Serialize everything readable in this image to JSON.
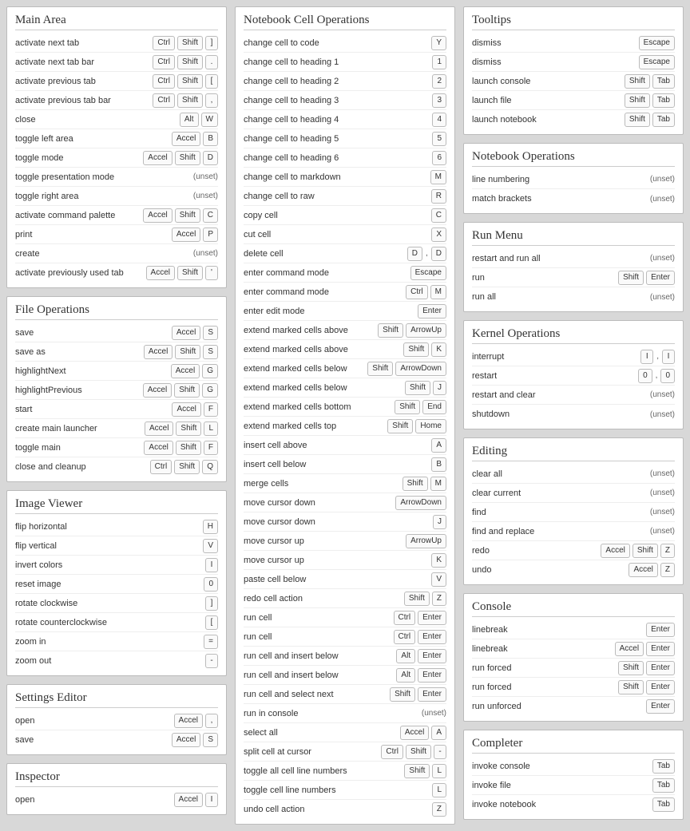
{
  "unset_label": "(unset)",
  "columns": [
    {
      "panels": [
        {
          "title": "Main Area",
          "rows": [
            {
              "label": "activate next tab",
              "keys": [
                "Ctrl",
                "Shift",
                "]"
              ]
            },
            {
              "label": "activate next tab bar",
              "keys": [
                "Ctrl",
                "Shift",
                "."
              ]
            },
            {
              "label": "activate previous tab",
              "keys": [
                "Ctrl",
                "Shift",
                "["
              ]
            },
            {
              "label": "activate previous tab bar",
              "keys": [
                "Ctrl",
                "Shift",
                ","
              ]
            },
            {
              "label": "close",
              "keys": [
                "Alt",
                "W"
              ]
            },
            {
              "label": "toggle left area",
              "keys": [
                "Accel",
                "B"
              ]
            },
            {
              "label": "toggle mode",
              "keys": [
                "Accel",
                "Shift",
                "D"
              ]
            },
            {
              "label": "toggle presentation mode",
              "unset": true
            },
            {
              "label": "toggle right area",
              "unset": true
            },
            {
              "label": "activate command palette",
              "keys": [
                "Accel",
                "Shift",
                "C"
              ]
            },
            {
              "label": "print",
              "keys": [
                "Accel",
                "P"
              ]
            },
            {
              "label": "create",
              "unset": true
            },
            {
              "label": "activate previously used tab",
              "keys": [
                "Accel",
                "Shift",
                "'"
              ]
            }
          ]
        },
        {
          "title": "File Operations",
          "rows": [
            {
              "label": "save",
              "keys": [
                "Accel",
                "S"
              ]
            },
            {
              "label": "save as",
              "keys": [
                "Accel",
                "Shift",
                "S"
              ]
            },
            {
              "label": "highlightNext",
              "keys": [
                "Accel",
                "G"
              ]
            },
            {
              "label": "highlightPrevious",
              "keys": [
                "Accel",
                "Shift",
                "G"
              ]
            },
            {
              "label": "start",
              "keys": [
                "Accel",
                "F"
              ]
            },
            {
              "label": "create main launcher",
              "keys": [
                "Accel",
                "Shift",
                "L"
              ]
            },
            {
              "label": "toggle main",
              "keys": [
                "Accel",
                "Shift",
                "F"
              ]
            },
            {
              "label": "close and cleanup",
              "keys": [
                "Ctrl",
                "Shift",
                "Q"
              ]
            }
          ]
        },
        {
          "title": "Image Viewer",
          "rows": [
            {
              "label": "flip horizontal",
              "keys": [
                "H"
              ]
            },
            {
              "label": "flip vertical",
              "keys": [
                "V"
              ]
            },
            {
              "label": "invert colors",
              "keys": [
                "I"
              ]
            },
            {
              "label": "reset image",
              "keys": [
                "0"
              ]
            },
            {
              "label": "rotate clockwise",
              "keys": [
                "]"
              ]
            },
            {
              "label": "rotate counterclockwise",
              "keys": [
                "["
              ]
            },
            {
              "label": "zoom in",
              "keys": [
                "="
              ]
            },
            {
              "label": "zoom out",
              "keys": [
                "-"
              ]
            }
          ]
        },
        {
          "title": "Settings Editor",
          "rows": [
            {
              "label": "open",
              "keys": [
                "Accel",
                ","
              ]
            },
            {
              "label": "save",
              "keys": [
                "Accel",
                "S"
              ]
            }
          ]
        },
        {
          "title": "Inspector",
          "rows": [
            {
              "label": "open",
              "keys": [
                "Accel",
                "I"
              ]
            }
          ]
        }
      ]
    },
    {
      "panels": [
        {
          "title": "Notebook Cell Operations",
          "rows": [
            {
              "label": "change cell to code",
              "keys": [
                "Y"
              ]
            },
            {
              "label": "change cell to heading 1",
              "keys": [
                "1"
              ]
            },
            {
              "label": "change cell to heading 2",
              "keys": [
                "2"
              ]
            },
            {
              "label": "change cell to heading 3",
              "keys": [
                "3"
              ]
            },
            {
              "label": "change cell to heading 4",
              "keys": [
                "4"
              ]
            },
            {
              "label": "change cell to heading 5",
              "keys": [
                "5"
              ]
            },
            {
              "label": "change cell to heading 6",
              "keys": [
                "6"
              ]
            },
            {
              "label": "change cell to markdown",
              "keys": [
                "M"
              ]
            },
            {
              "label": "change cell to raw",
              "keys": [
                "R"
              ]
            },
            {
              "label": "copy cell",
              "keys": [
                "C"
              ]
            },
            {
              "label": "cut cell",
              "keys": [
                "X"
              ]
            },
            {
              "label": "delete cell",
              "chord": [
                [
                  "D"
                ],
                [
                  "D"
                ]
              ]
            },
            {
              "label": "enter command mode",
              "keys": [
                "Escape"
              ]
            },
            {
              "label": "enter command mode",
              "keys": [
                "Ctrl",
                "M"
              ]
            },
            {
              "label": "enter edit mode",
              "keys": [
                "Enter"
              ]
            },
            {
              "label": "extend marked cells above",
              "keys": [
                "Shift",
                "ArrowUp"
              ]
            },
            {
              "label": "extend marked cells above",
              "keys": [
                "Shift",
                "K"
              ]
            },
            {
              "label": "extend marked cells below",
              "keys": [
                "Shift",
                "ArrowDown"
              ]
            },
            {
              "label": "extend marked cells below",
              "keys": [
                "Shift",
                "J"
              ]
            },
            {
              "label": "extend marked cells bottom",
              "keys": [
                "Shift",
                "End"
              ]
            },
            {
              "label": "extend marked cells top",
              "keys": [
                "Shift",
                "Home"
              ]
            },
            {
              "label": "insert cell above",
              "keys": [
                "A"
              ]
            },
            {
              "label": "insert cell below",
              "keys": [
                "B"
              ]
            },
            {
              "label": "merge cells",
              "keys": [
                "Shift",
                "M"
              ]
            },
            {
              "label": "move cursor down",
              "keys": [
                "ArrowDown"
              ]
            },
            {
              "label": "move cursor down",
              "keys": [
                "J"
              ]
            },
            {
              "label": "move cursor up",
              "keys": [
                "ArrowUp"
              ]
            },
            {
              "label": "move cursor up",
              "keys": [
                "K"
              ]
            },
            {
              "label": "paste cell below",
              "keys": [
                "V"
              ]
            },
            {
              "label": "redo cell action",
              "keys": [
                "Shift",
                "Z"
              ]
            },
            {
              "label": "run cell",
              "keys": [
                "Ctrl",
                "Enter"
              ]
            },
            {
              "label": "run cell",
              "keys": [
                "Ctrl",
                "Enter"
              ]
            },
            {
              "label": "run cell and insert below",
              "keys": [
                "Alt",
                "Enter"
              ]
            },
            {
              "label": "run cell and insert below",
              "keys": [
                "Alt",
                "Enter"
              ]
            },
            {
              "label": "run cell and select next",
              "keys": [
                "Shift",
                "Enter"
              ]
            },
            {
              "label": "run in console",
              "unset": true
            },
            {
              "label": "select all",
              "keys": [
                "Accel",
                "A"
              ]
            },
            {
              "label": "split cell at cursor",
              "keys": [
                "Ctrl",
                "Shift",
                "-"
              ]
            },
            {
              "label": "toggle all cell line numbers",
              "keys": [
                "Shift",
                "L"
              ]
            },
            {
              "label": "toggle cell line numbers",
              "keys": [
                "L"
              ]
            },
            {
              "label": "undo cell action",
              "keys": [
                "Z"
              ]
            }
          ]
        }
      ]
    },
    {
      "panels": [
        {
          "title": "Tooltips",
          "rows": [
            {
              "label": "dismiss",
              "keys": [
                "Escape"
              ]
            },
            {
              "label": "dismiss",
              "keys": [
                "Escape"
              ]
            },
            {
              "label": "launch console",
              "keys": [
                "Shift",
                "Tab"
              ]
            },
            {
              "label": "launch file",
              "keys": [
                "Shift",
                "Tab"
              ]
            },
            {
              "label": "launch notebook",
              "keys": [
                "Shift",
                "Tab"
              ]
            }
          ]
        },
        {
          "title": "Notebook Operations",
          "rows": [
            {
              "label": "line numbering",
              "unset": true
            },
            {
              "label": "match brackets",
              "unset": true
            }
          ]
        },
        {
          "title": "Run Menu",
          "rows": [
            {
              "label": "restart and run all",
              "unset": true
            },
            {
              "label": "run",
              "keys": [
                "Shift",
                "Enter"
              ]
            },
            {
              "label": "run all",
              "unset": true
            }
          ]
        },
        {
          "title": "Kernel Operations",
          "rows": [
            {
              "label": "interrupt",
              "chord": [
                [
                  "I"
                ],
                [
                  "I"
                ]
              ]
            },
            {
              "label": "restart",
              "chord": [
                [
                  "0"
                ],
                [
                  "0"
                ]
              ]
            },
            {
              "label": "restart and clear",
              "unset": true
            },
            {
              "label": "shutdown",
              "unset": true
            }
          ]
        },
        {
          "title": "Editing",
          "rows": [
            {
              "label": "clear all",
              "unset": true
            },
            {
              "label": "clear current",
              "unset": true
            },
            {
              "label": "find",
              "unset": true
            },
            {
              "label": "find and replace",
              "unset": true
            },
            {
              "label": "redo",
              "keys": [
                "Accel",
                "Shift",
                "Z"
              ]
            },
            {
              "label": "undo",
              "keys": [
                "Accel",
                "Z"
              ]
            }
          ]
        },
        {
          "title": "Console",
          "rows": [
            {
              "label": "linebreak",
              "keys": [
                "Enter"
              ]
            },
            {
              "label": "linebreak",
              "keys": [
                "Accel",
                "Enter"
              ]
            },
            {
              "label": "run forced",
              "keys": [
                "Shift",
                "Enter"
              ]
            },
            {
              "label": "run forced",
              "keys": [
                "Shift",
                "Enter"
              ]
            },
            {
              "label": "run unforced",
              "keys": [
                "Enter"
              ]
            }
          ]
        },
        {
          "title": "Completer",
          "rows": [
            {
              "label": "invoke console",
              "keys": [
                "Tab"
              ]
            },
            {
              "label": "invoke file",
              "keys": [
                "Tab"
              ]
            },
            {
              "label": "invoke notebook",
              "keys": [
                "Tab"
              ]
            }
          ]
        }
      ]
    }
  ]
}
